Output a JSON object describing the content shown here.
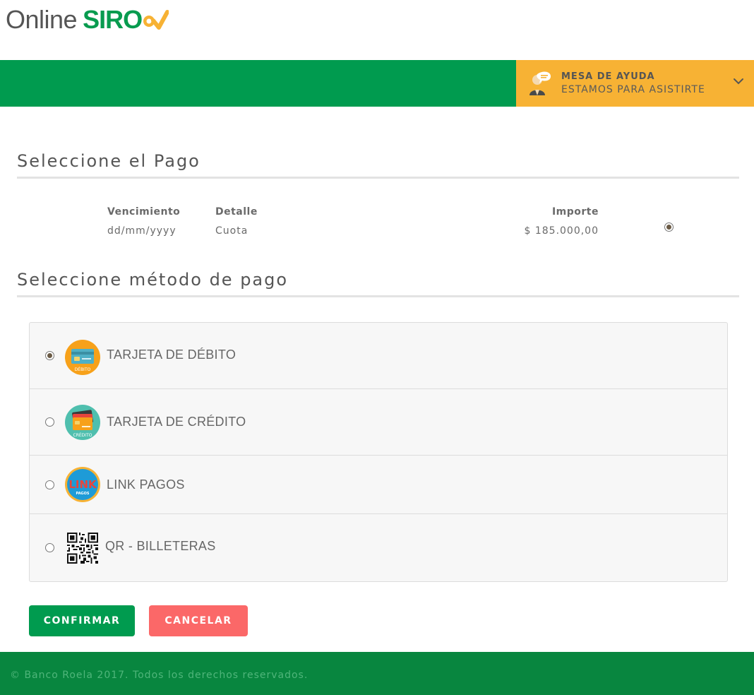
{
  "logo": {
    "online": "Online",
    "siro": "SIRO"
  },
  "help_desk": {
    "title": "MESA DE AYUDA",
    "subtitle": "ESTAMOS PARA ASISTIRTE"
  },
  "payment_section": {
    "title": "Seleccione el Pago",
    "headers": {
      "due": "Vencimiento",
      "detail": "Detalle",
      "amount": "Importe"
    },
    "rows": [
      {
        "due": "dd/mm/yyyy",
        "detail": "Cuota",
        "amount": "$ 185.000,00",
        "selected": true
      }
    ]
  },
  "method_section": {
    "title": "Seleccione método de pago",
    "methods": [
      {
        "label": "TARJETA DE DÉBITO",
        "icon": "debit-card-icon",
        "icon_text": "DÉBITO",
        "selected": true
      },
      {
        "label": "TARJETA DE CRÉDITO",
        "icon": "credit-card-icon",
        "icon_text": "CRÉDITO",
        "selected": false
      },
      {
        "label": "LINK PAGOS",
        "icon": "link-pagos-icon",
        "icon_text": "LINK",
        "icon_subtext": "PAGOS",
        "selected": false
      },
      {
        "label": "QR - BILLETERAS",
        "icon": "qr-code-icon",
        "selected": false
      }
    ]
  },
  "buttons": {
    "confirm": "CONFIRMAR",
    "cancel": "CANCELAR"
  },
  "footer": {
    "text": "© Banco Roela 2017. Todos los derechos reservados."
  },
  "colors": {
    "brand_green": "#009b4f",
    "help_orange": "#f7b234",
    "cancel_red": "#fb6868",
    "footer_green": "#08863f"
  }
}
